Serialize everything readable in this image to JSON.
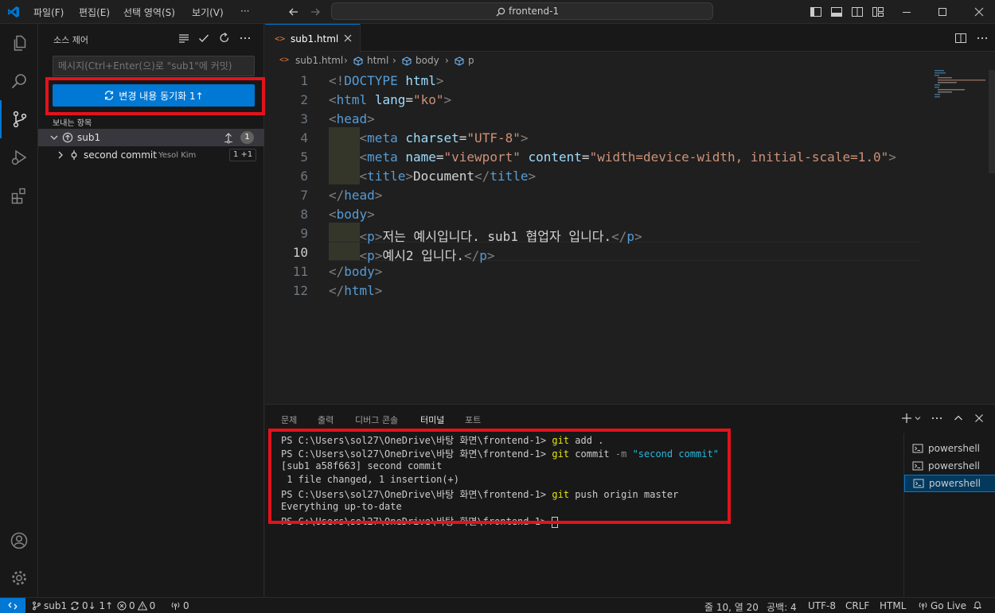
{
  "menu": {
    "file": "파일(F)",
    "edit": "편집(E)",
    "selection": "선택 영역(S)",
    "view": "보기(V)",
    "more": "···"
  },
  "command_center": {
    "text": "frontend-1"
  },
  "sidebar": {
    "title": "소스 제어",
    "commit_placeholder": "메시지(Ctrl+Enter(으)로 \"sub1\"에 커밋)",
    "sync_button": "변경 내용 동기화 1↑",
    "outgoing_label": "보내는 항목",
    "branch": {
      "name": "sub1",
      "badge": "1"
    },
    "commit": {
      "message": "second commit",
      "author": "Yesol Kim",
      "stats": "1 +1"
    }
  },
  "editor": {
    "tab_label": "sub1.html",
    "breadcrumb": [
      "sub1.html",
      "html",
      "body",
      "p"
    ],
    "line_numbers": [
      "1",
      "2",
      "3",
      "4",
      "5",
      "6",
      "7",
      "8",
      "9",
      "10",
      "11",
      "12"
    ],
    "current_line": "10",
    "line9_text": "저는 예시입니다. sub1 협업자 입니다.",
    "line10_text": "예시2 입니다.",
    "title_text": "Document"
  },
  "panel": {
    "tabs": [
      "문제",
      "출력",
      "디버그 콘솔",
      "터미널",
      "포트"
    ],
    "active_tab": "터미널",
    "terminal": {
      "prompt": "PS C:\\Users\\sol27\\OneDrive\\바탕 화면\\frontend-1>",
      "cmd1_git": "git",
      "cmd1_rest": " add .",
      "cmd2_git": "git",
      "cmd2_rest": " commit ",
      "cmd2_flag": "-m",
      "cmd2_msg": "\"second commit\"",
      "out1": "[sub1 a58f663] second commit",
      "out2": " 1 file changed, 1 insertion(+)",
      "cmd3_git": "git",
      "cmd3_rest": " push origin master",
      "out3": "Everything up-to-date"
    },
    "terminals": [
      "powershell",
      "powershell",
      "powershell"
    ]
  },
  "status": {
    "branch": "sub1",
    "sync": "0↓ 1↑",
    "errors": "0",
    "warnings": "0",
    "ports": "0",
    "position": "줄 10, 열 20",
    "spaces": "공백: 4",
    "encoding": "UTF-8",
    "eol": "CRLF",
    "language": "HTML",
    "golive": "Go Live"
  },
  "colors": {
    "accent": "#0078d4",
    "highlight_box": "#e3121c",
    "background": "#1f1f1f"
  }
}
